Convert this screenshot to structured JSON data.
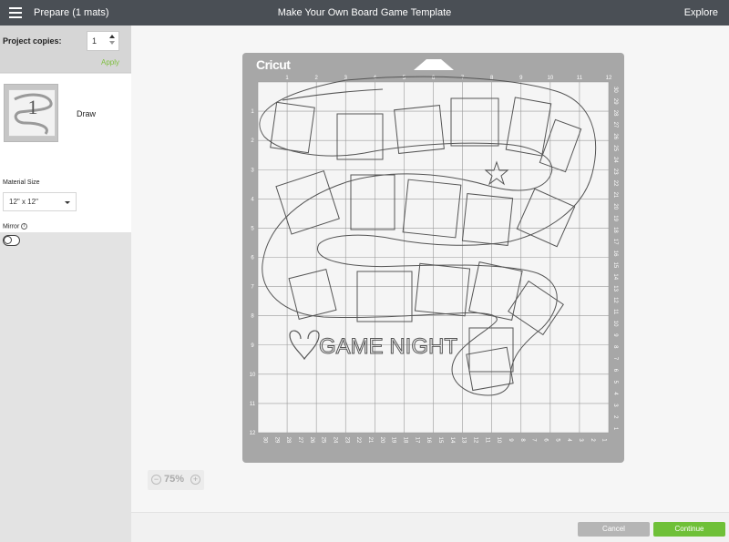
{
  "topbar": {
    "menu_icon": "hamburger-icon",
    "prepare_label": "Prepare (1 mats)",
    "title": "Make Your Own Board Game Template",
    "explore_label": "Explore"
  },
  "left_panel": {
    "copies_label": "Project copies:",
    "copies_value": "1",
    "apply_label": "Apply",
    "mat_number": "1",
    "mat_mode_label": "Draw",
    "material_size_label": "Material Size",
    "material_size_value": "12\" x 12\"",
    "mirror_label": "Mirror",
    "mirror_on": false
  },
  "canvas": {
    "brand": "Cricut",
    "design_text": "GAME NIGHT",
    "zoom_label": "75%",
    "zoom_minus": "−",
    "zoom_plus": "+",
    "top_ruler": [
      "1",
      "2",
      "3",
      "4",
      "5",
      "6",
      "7",
      "8",
      "9",
      "10",
      "11",
      "12"
    ],
    "left_ruler": [
      "1",
      "2",
      "3",
      "4",
      "5",
      "6",
      "7",
      "8",
      "9",
      "10",
      "11",
      "12"
    ],
    "right_ruler": [
      "30",
      "29",
      "28",
      "27",
      "26",
      "25",
      "24",
      "23",
      "22",
      "21",
      "20",
      "19",
      "18",
      "17",
      "16",
      "15",
      "14",
      "13",
      "12",
      "11",
      "10",
      "9",
      "8",
      "7",
      "6",
      "5",
      "4",
      "3",
      "2",
      "1"
    ],
    "bottom_ruler": [
      "30",
      "29",
      "28",
      "27",
      "26",
      "25",
      "24",
      "23",
      "22",
      "21",
      "20",
      "19",
      "18",
      "17",
      "16",
      "15",
      "14",
      "13",
      "12",
      "11",
      "10",
      "9",
      "8",
      "7",
      "6",
      "5",
      "4",
      "3",
      "2",
      "1"
    ]
  },
  "footer": {
    "cancel_label": "Cancel",
    "continue_label": "Continue"
  },
  "colors": {
    "topbar": "#4a4f55",
    "accent_green": "#6fc038",
    "mat_gray": "#a7a7a7"
  }
}
